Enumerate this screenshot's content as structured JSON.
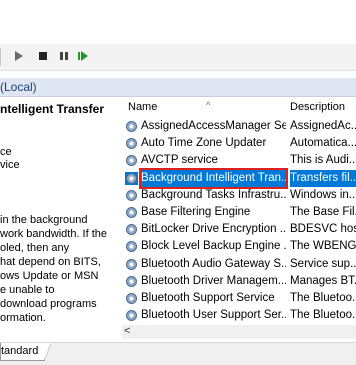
{
  "toolbar": {
    "buttons": [
      "play-icon",
      "stop-icon",
      "pause-icon",
      "restart-icon"
    ]
  },
  "tree_header": {
    "label": "(Local)"
  },
  "description_pane": {
    "title": "ntelligent Transfer",
    "lines": [
      {
        "text": "ce"
      },
      {
        "text": "vice"
      },
      {
        "text": " in the background"
      },
      {
        "text": "work bandwidth. If the"
      },
      {
        "text": "oled, then any"
      },
      {
        "text": "hat depend on BITS,"
      },
      {
        "text": "ows Update or MSN"
      },
      {
        "text": "e unable to"
      },
      {
        "text": "download programs"
      },
      {
        "text": "ormation."
      }
    ]
  },
  "list": {
    "columns": {
      "name": "Name",
      "description": "Description"
    },
    "rows": [
      {
        "name": "AssignedAccessManager Se...",
        "desc": "AssignedAc..."
      },
      {
        "name": "Auto Time Zone Updater",
        "desc": "Automatica..."
      },
      {
        "name": "AVCTP service",
        "desc": "This is Audi..."
      },
      {
        "name": "Background Intelligent Tran...",
        "desc": "Transfers fil...",
        "selected": true
      },
      {
        "name": "Background Tasks Infrastru...",
        "desc": "Windows in..."
      },
      {
        "name": "Base Filtering Engine",
        "desc": "The Base Fil..."
      },
      {
        "name": "BitLocker Drive Encryption ...",
        "desc": "BDESVC hos..."
      },
      {
        "name": "Block Level Backup Engine ...",
        "desc": "The WBENG..."
      },
      {
        "name": "Bluetooth Audio Gateway S...",
        "desc": "Service sup..."
      },
      {
        "name": "Bluetooth Driver Managem...",
        "desc": "Manages BT..."
      },
      {
        "name": "Bluetooth Support Service",
        "desc": "The Bluetoo..."
      },
      {
        "name": "Bluetooth User Support Ser...",
        "desc": "The Bluetoo..."
      }
    ]
  },
  "bottom_tabs": {
    "standard": "tandard"
  },
  "scroll": {
    "left_arrow": "<"
  },
  "colors": {
    "selection": "#0078d7",
    "highlight_border": "#e0201c"
  }
}
